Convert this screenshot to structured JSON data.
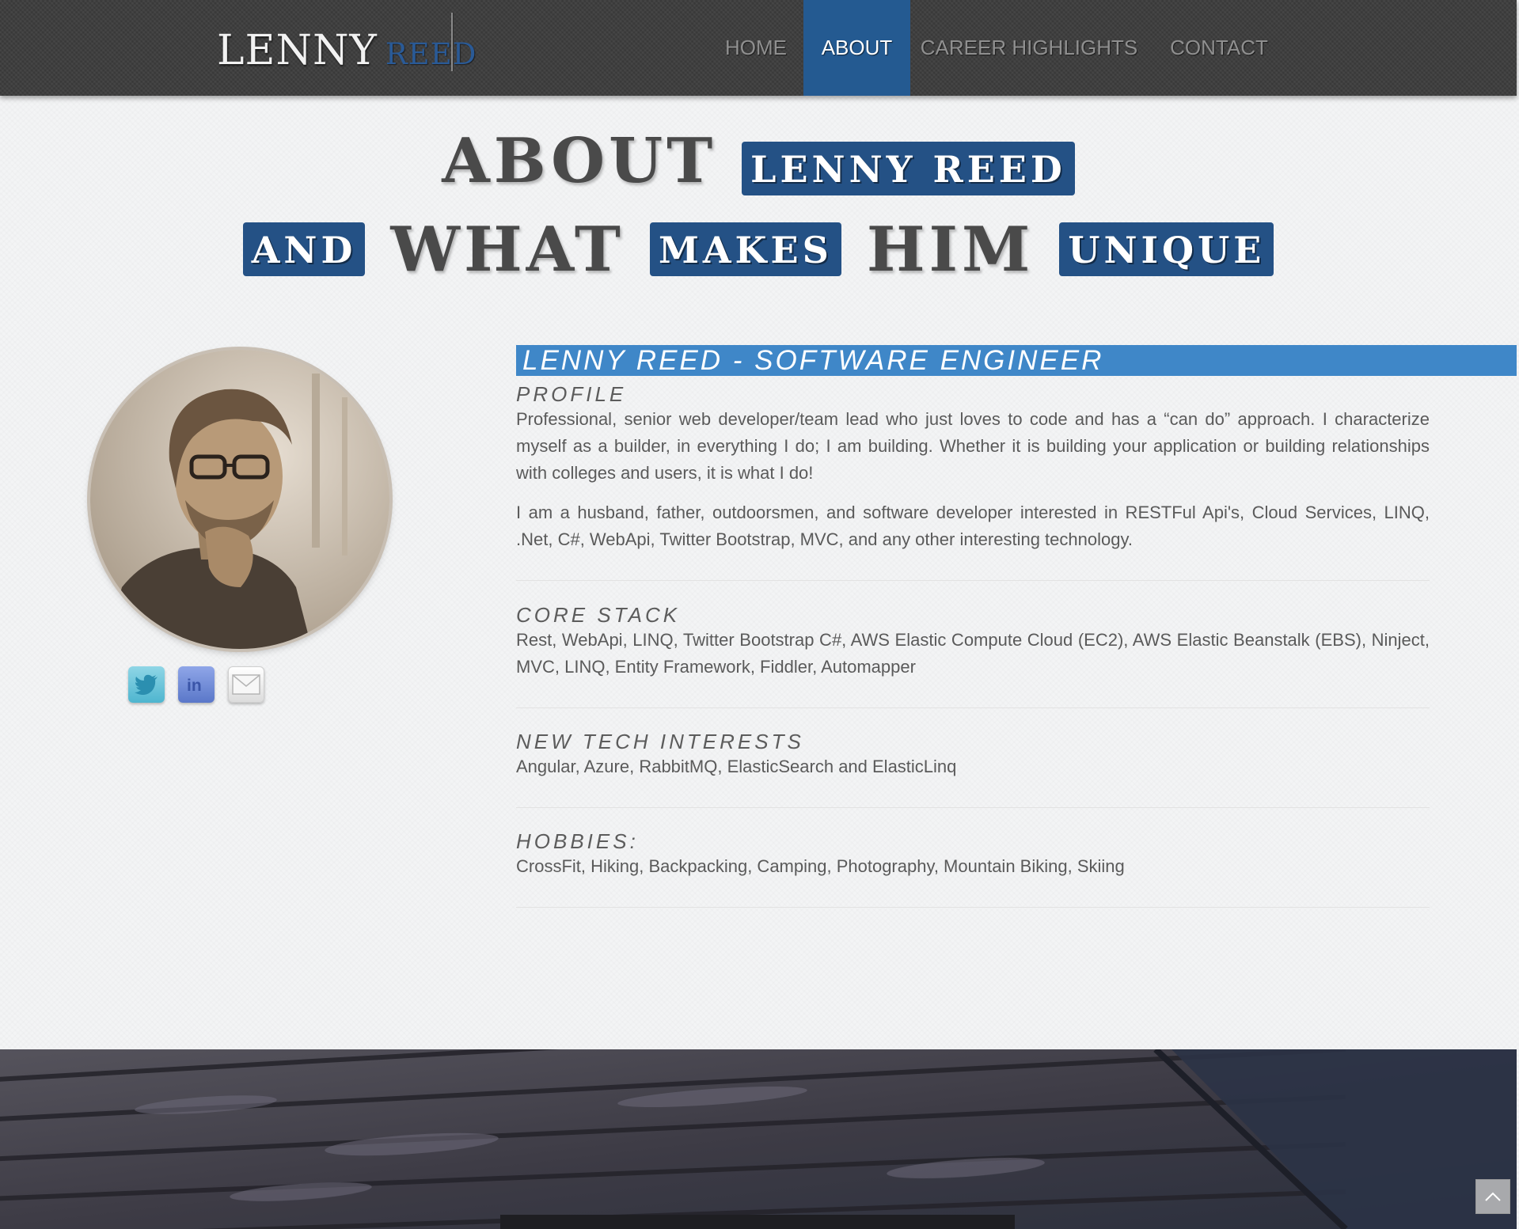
{
  "brand": {
    "first": "LENNY",
    "last": "REED"
  },
  "nav": {
    "home": "HOME",
    "about": "ABOUT",
    "career": "CAREER HIGHLIGHTS",
    "contact": "CONTACT",
    "active": "ABOUT"
  },
  "heading": {
    "line1": {
      "word1": "ABOUT",
      "chip1": "LENNY REED"
    },
    "line2": {
      "chip1": "AND",
      "word1": "WHAT",
      "chip2": "MAKES",
      "word2": "HIM",
      "chip3": "UNIQUE"
    }
  },
  "profile_card": {
    "social": [
      "twitter-icon",
      "linkedin-icon",
      "email-icon"
    ]
  },
  "content": {
    "title": "LENNY REED - SOFTWARE ENGINEER",
    "profile_label": "PROFILE",
    "profile_p1": "Professional, senior web developer/team lead who just loves to code and has a “can do” approach. I characterize myself as a builder, in everything I do; I am building. Whether it is building your application or building relationships with colleges and users, it is what I do!",
    "profile_p2": "I am a husband, father, outdoorsmen, and software developer interested in RESTFul Api's, Cloud Services, LINQ, .Net, C#, WebApi, Twitter Bootstrap, MVC, and any other interesting technology.",
    "core_label": "CORE STACK",
    "core_text": "Rest, WebApi, LINQ, Twitter Bootstrap C#, AWS Elastic Compute Cloud (EC2), AWS Elastic Beanstalk (EBS), Ninject, MVC, LINQ, Entity Framework, Fiddler, Automapper",
    "newtech_label": "NEW TECH INTERESTS",
    "newtech_text": "Angular, Azure, RabbitMQ, ElasticSearch and ElasticLinq",
    "hobbies_label": "HOBBIES:",
    "hobbies_text": "CrossFit, Hiking, Backpacking, Camping, Photography, Mountain Biking, Skiing"
  },
  "colors": {
    "navbar": "#3f3f3f",
    "accent_blue": "#245a91",
    "title_bar": "#3f87c8",
    "text": "#5a5a5a"
  },
  "footer": {
    "scroll_top_icon": "chevron-up-icon"
  }
}
